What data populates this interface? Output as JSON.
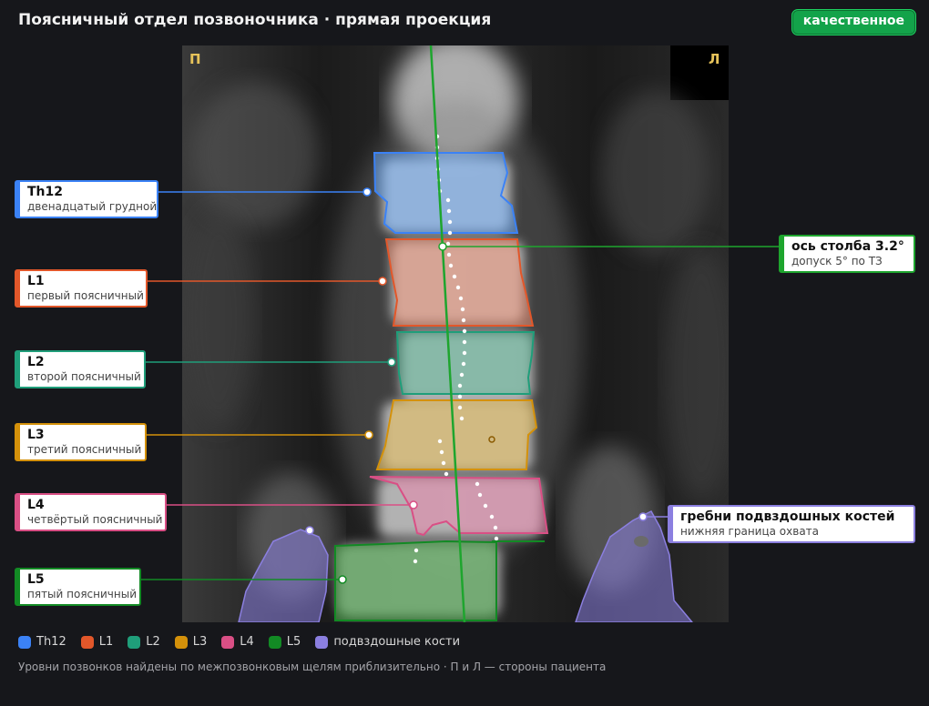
{
  "header": {
    "title": "Поясничный отдел позвоночника · прямая проекция",
    "badge": "качественное",
    "badge_color": "#13a34a"
  },
  "image": {
    "side_right_marker": "П",
    "side_left_marker": "Л"
  },
  "vertebrae": [
    {
      "id": "th12",
      "name": "Th12",
      "desc": "двенадцатый грудной",
      "color": "#3b82f6"
    },
    {
      "id": "l1",
      "name": "L1",
      "desc": "первый поясничный",
      "color": "#e2572a"
    },
    {
      "id": "l2",
      "name": "L2",
      "desc": "второй поясничный",
      "color": "#1f9e7a"
    },
    {
      "id": "l3",
      "name": "L3",
      "desc": "третий поясничный",
      "color": "#d4910a"
    },
    {
      "id": "l4",
      "name": "L4",
      "desc": "четвёртый поясничный",
      "color": "#d94f85"
    },
    {
      "id": "l5",
      "name": "L5",
      "desc": "пятый поясничный",
      "color": "#128a24"
    }
  ],
  "axis": {
    "name": "ось столба 3.2°",
    "desc": "допуск 5° по ТЗ",
    "color": "#1ea52e"
  },
  "iliac": {
    "name": "гребни подвздошных костей",
    "desc": "нижняя граница охвата",
    "color": "#8b7fe0"
  },
  "legend": [
    {
      "label": "Th12",
      "color": "#3b82f6"
    },
    {
      "label": "L1",
      "color": "#e2572a"
    },
    {
      "label": "L2",
      "color": "#1f9e7a"
    },
    {
      "label": "L3",
      "color": "#d4910a"
    },
    {
      "label": "L4",
      "color": "#d94f85"
    },
    {
      "label": "L5",
      "color": "#128a24"
    },
    {
      "label": "подвздошные кости",
      "color": "#8b7fe0"
    }
  ],
  "footer": {
    "note": "Уровни позвонков найдены по межпозвонковым щелям приблизительно · П и Л — стороны пациента"
  }
}
